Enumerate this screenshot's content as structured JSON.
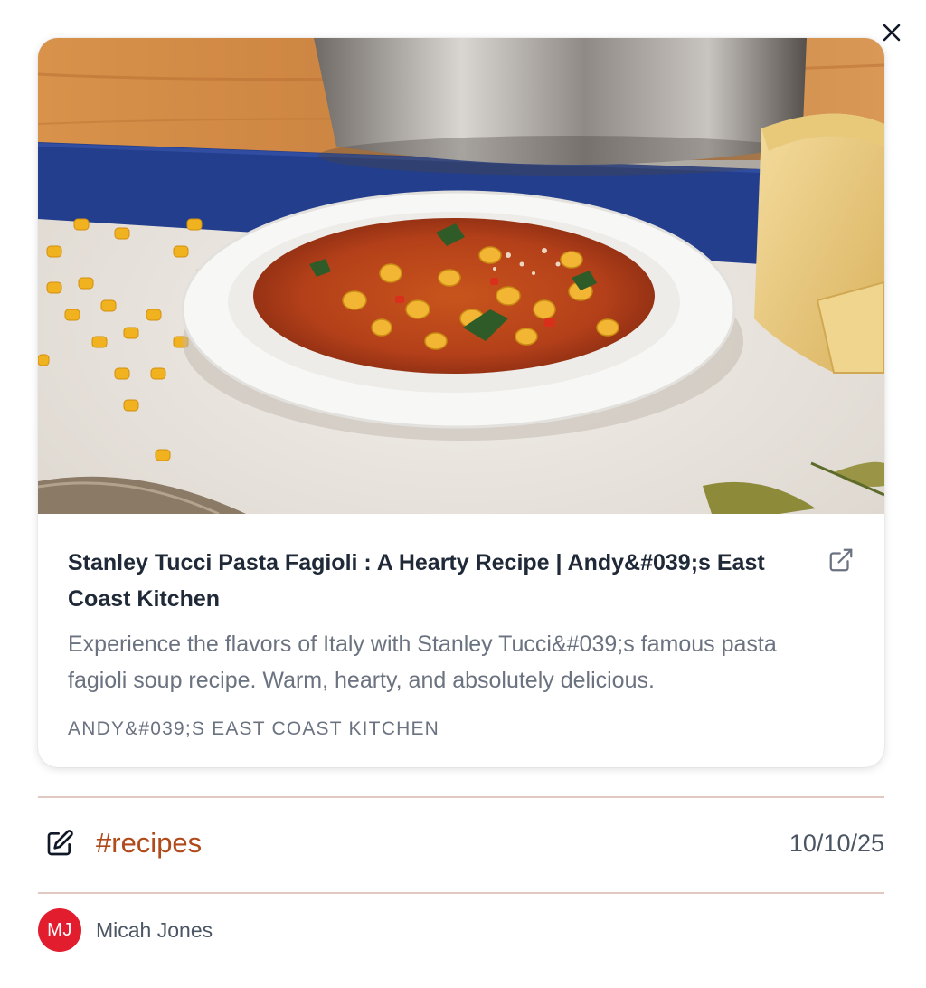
{
  "close": {
    "icon": "close-icon"
  },
  "card": {
    "title": "Stanley Tucci Pasta Fagioli : A Hearty Recipe | Andy&#039;s East Coast Kitchen",
    "description": "Experience the flavors of Italy with Stanley Tucci&#039;s famous pasta fagioli soup recipe. Warm, hearty, and absolutely delicious.",
    "source": "ANDY&#039;S EAST COAST KITCHEN",
    "external_icon": "external-link-icon",
    "image_alt": "Bowl of pasta fagioli soup with ditalini pasta, parmesan wedge and a hammered metal pot"
  },
  "meta": {
    "edit_icon": "edit-icon",
    "tag": "#recipes",
    "date": "10/10/25"
  },
  "author": {
    "initials": "MJ",
    "name": "Micah Jones",
    "avatar_color": "#e11d2e"
  },
  "colors": {
    "tag": "#b04a1a",
    "divider": "#dfc9c1"
  }
}
